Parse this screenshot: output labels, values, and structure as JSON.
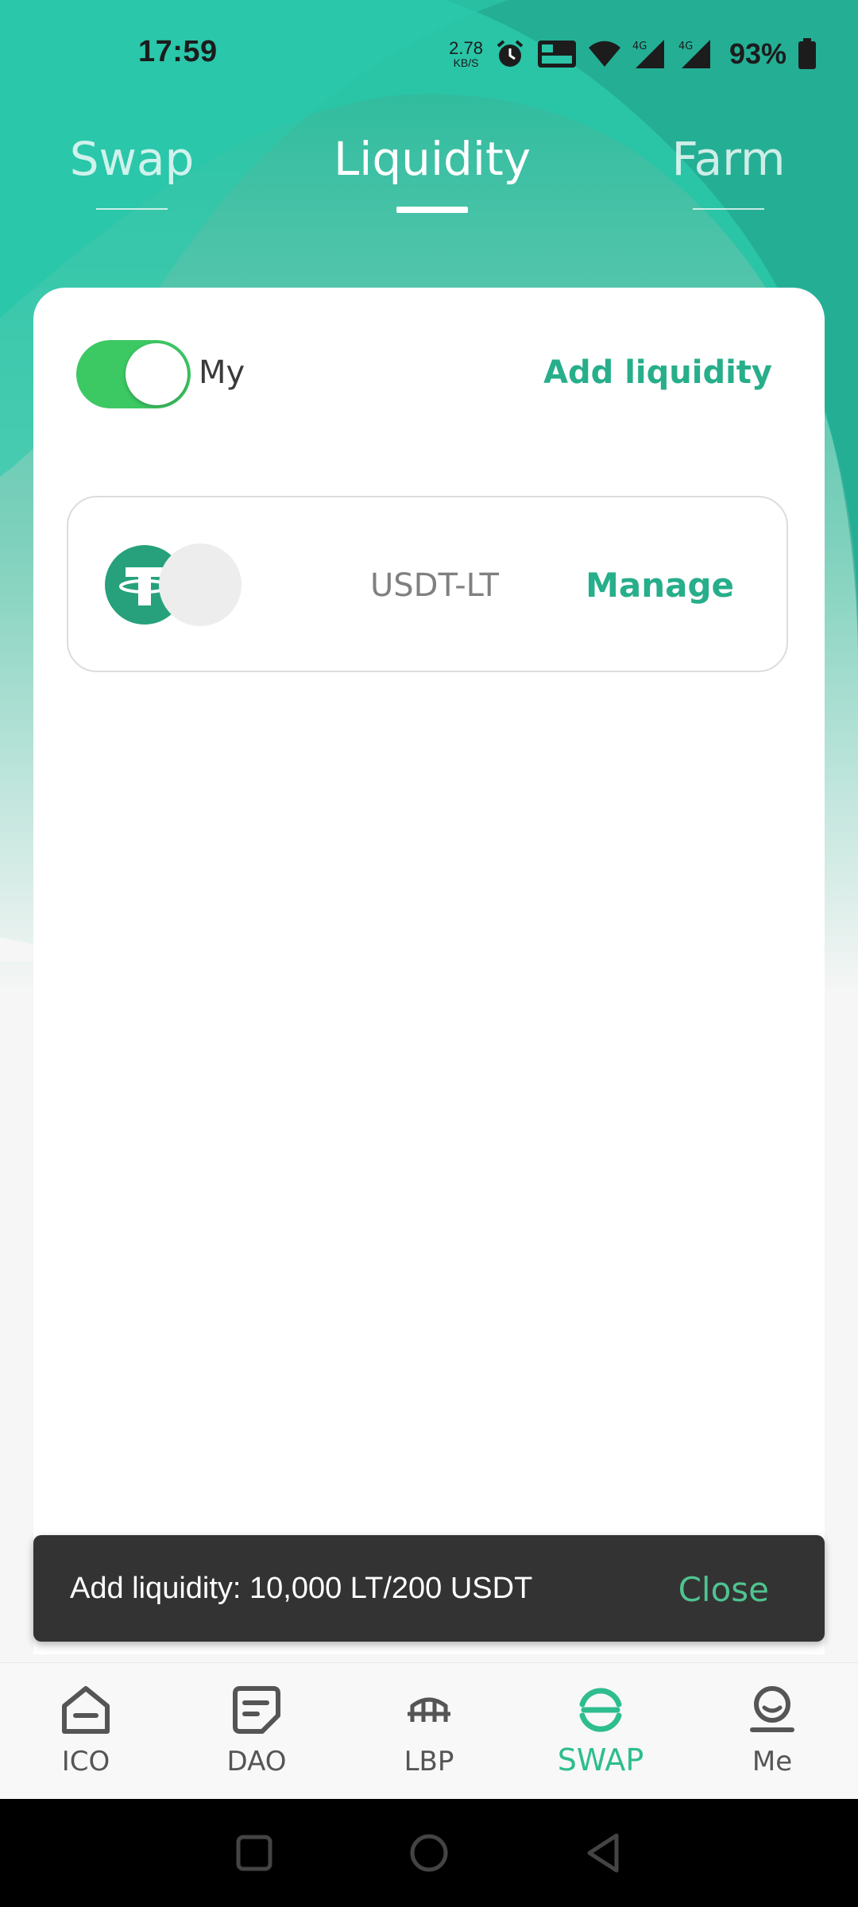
{
  "status_bar": {
    "time": "17:59",
    "net_speed_value": "2.78",
    "net_speed_unit": "KB/S",
    "battery_percent": "93%",
    "icons": [
      "alarm-icon",
      "volte-icon",
      "wifi-icon",
      "signal-4g-icon",
      "signal-4g-icon",
      "battery-icon"
    ]
  },
  "tabs": [
    {
      "label": "Swap",
      "active": false
    },
    {
      "label": "Liquidity",
      "active": true
    },
    {
      "label": "Farm",
      "active": false
    }
  ],
  "liquidity": {
    "toggle_label": "My",
    "toggle_on": true,
    "add_label": "Add liquidity",
    "pairs": [
      {
        "name": "USDT-LT",
        "action": "Manage",
        "token_icons": [
          "tether-icon",
          "lt-token-icon"
        ]
      }
    ]
  },
  "toast": {
    "message": "Add liquidity: 10,000 LT/200 USDT",
    "action": "Close"
  },
  "bottom_nav": [
    {
      "label": "ICO",
      "icon": "home-icon",
      "active": false
    },
    {
      "label": "DAO",
      "icon": "document-icon",
      "active": false
    },
    {
      "label": "LBP",
      "icon": "bridge-icon",
      "active": false
    },
    {
      "label": "SWAP",
      "icon": "swap-icon",
      "active": true
    },
    {
      "label": "Me",
      "icon": "profile-icon",
      "active": false
    }
  ],
  "colors": {
    "accent": "#27ae8a",
    "header_green": "#2bc4a5",
    "toggle_green": "#3cc863",
    "toast_bg": "#333333",
    "tether_green": "#26a17b"
  }
}
